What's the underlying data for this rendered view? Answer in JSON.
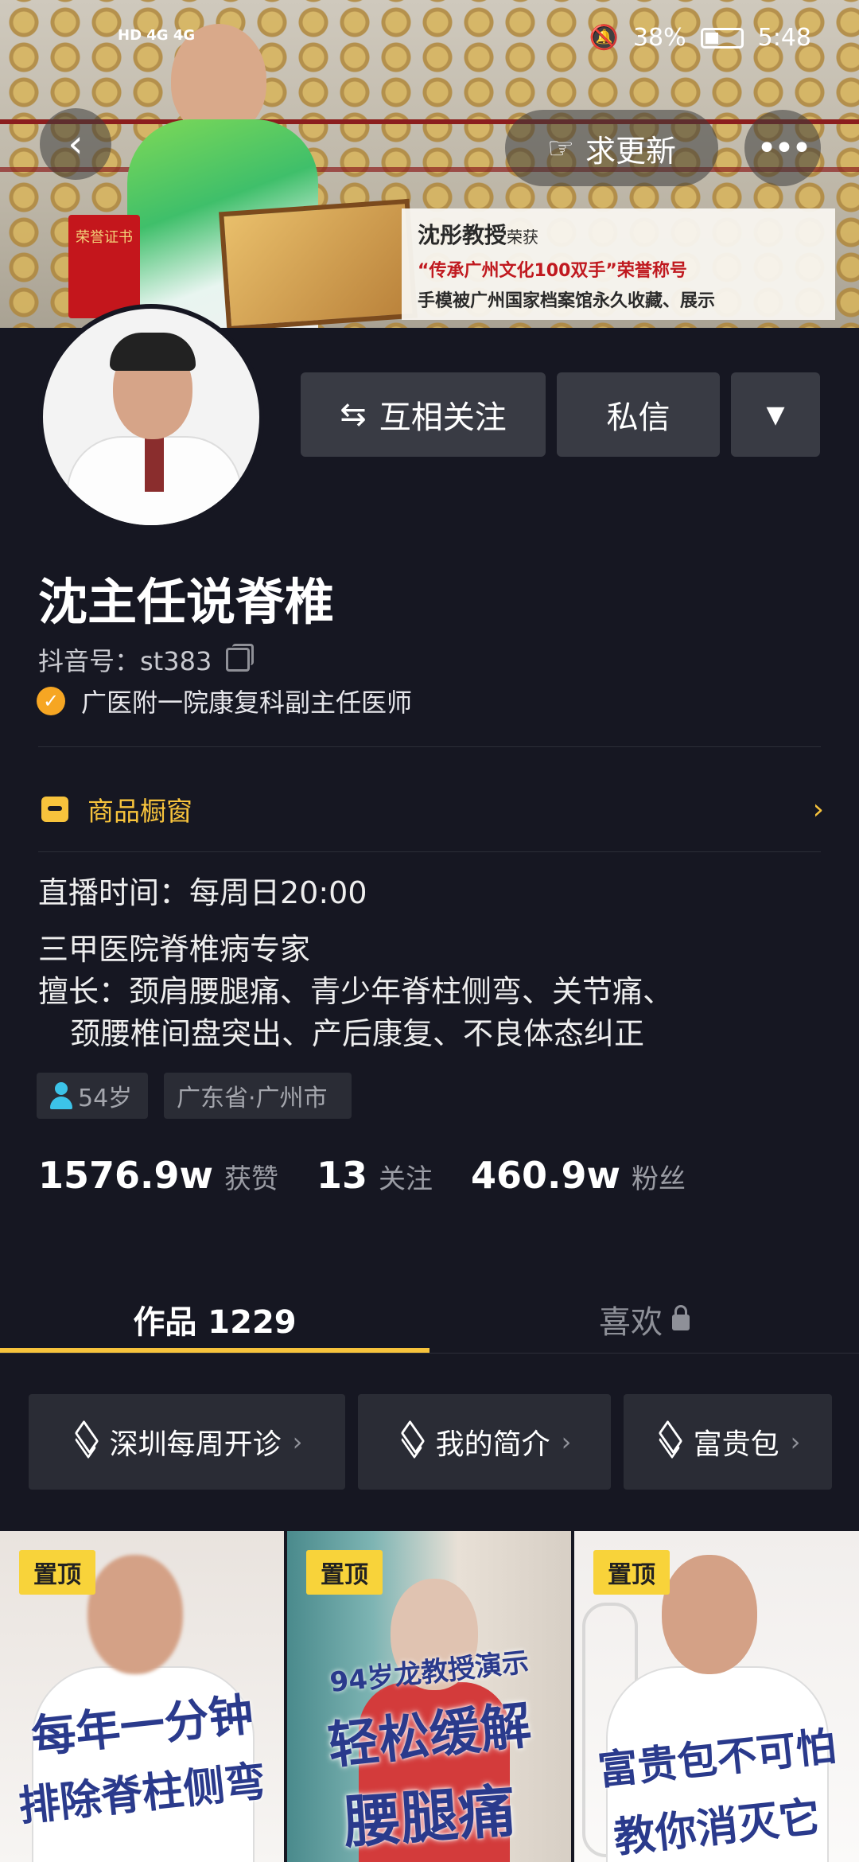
{
  "status_bar": {
    "network_label": "HD 4G 4G",
    "battery": "38%",
    "time": "5:48"
  },
  "banner": {
    "certificate_text": "荣誉证书",
    "caption_line1_name": "沈彤教授",
    "caption_line1_suffix": "荣获",
    "caption_line2": "“传承广州文化100双手”荣誉称号",
    "caption_line3": "手模被广州国家档案馆永久收藏、展示"
  },
  "top_bar": {
    "back": "‹",
    "update_label": "求更新",
    "more": "•••"
  },
  "actions": {
    "mutual_follow": "互相关注",
    "message": "私信",
    "dropdown": "▼"
  },
  "profile": {
    "nickname": "沈主任说脊椎",
    "douyin_id": "抖音号：st383",
    "verification": "广医附一院康复科副主任医师"
  },
  "shop": {
    "label": "商品橱窗",
    "arrow": "›"
  },
  "bio": {
    "line1": "直播时间：每周日20:00",
    "line2": "三甲医院脊椎病专家",
    "line3": "擅长：颈肩腰腿痛、青少年脊柱侧弯、关节痛、",
    "line4": "颈腰椎间盘突出、产后康复、不良体态纠正"
  },
  "tags": {
    "age": "54岁",
    "location": "广东省·广州市"
  },
  "stats": {
    "likes_value": "1576.9w",
    "likes_label": "获赞",
    "following_value": "13",
    "following_label": "关注",
    "followers_value": "460.9w",
    "followers_label": "粉丝"
  },
  "tabs": {
    "works": "作品 1229",
    "likes": "喜欢"
  },
  "collections": [
    {
      "label": "深圳每周开诊"
    },
    {
      "label": "我的简介"
    },
    {
      "label": "富贵包"
    }
  ],
  "videos": [
    {
      "pin": "置顶",
      "text1": "每年一分钟",
      "text2": "排除脊柱侧弯"
    },
    {
      "pin": "置顶",
      "text1": "94岁龙教授演示",
      "text2": "轻松缓解",
      "text3": "腰腿痛"
    },
    {
      "pin": "置顶",
      "text1": "富贵包不可怕",
      "text2": "教你消灭它"
    }
  ],
  "colors": {
    "background": "#161722",
    "accent": "#f7c33c",
    "verify": "#f6a623"
  }
}
